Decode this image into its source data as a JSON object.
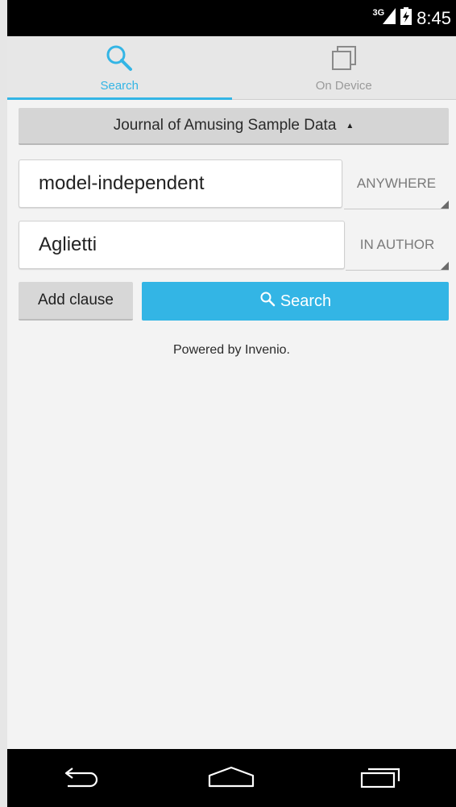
{
  "status_bar": {
    "network_type": "3G",
    "time": "8:45"
  },
  "tabs": [
    {
      "label": "Search",
      "icon": "search-icon",
      "active": true
    },
    {
      "label": "On Device",
      "icon": "copy-icon",
      "active": false
    }
  ],
  "collection": {
    "selected": "Journal of Amusing Sample Data"
  },
  "clauses": [
    {
      "value": "model-independent",
      "scope": "ANYWHERE"
    },
    {
      "value": "Aglietti",
      "scope": "IN AUTHOR"
    }
  ],
  "buttons": {
    "add_clause": "Add clause",
    "search": "Search"
  },
  "footer_text": "Powered by Invenio.",
  "colors": {
    "accent": "#33b5e5",
    "status_bar": "#000000",
    "nav_bar": "#000000"
  }
}
